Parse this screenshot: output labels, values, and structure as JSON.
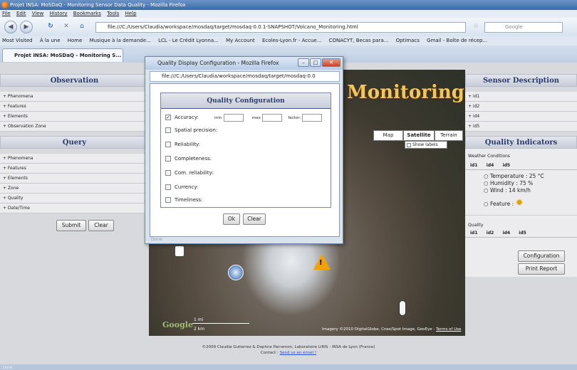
{
  "window": {
    "title": "Projet INSA: MoSDaQ - Monitoring Sensor Data Quality - Mozilla Firefox"
  },
  "menu": [
    "File",
    "Edit",
    "View",
    "History",
    "Bookmarks",
    "Tools",
    "Help"
  ],
  "nav": {
    "url": "file:///C:/Users/Claudia/workspace/mosdaq/target/mosdaq-0.0.1-SNAPSHOT/Volcano_Monitoring.html",
    "search_placeholder": "Google"
  },
  "bookmarks": [
    "Most Visited",
    "À la une",
    "Home",
    "Musique à la demande...",
    "LCL - Le Crédit Lyonna...",
    "My Account",
    "Ecoles-Lyon.fr - Accue...",
    "CONACYT, Becas para...",
    "Optimacs",
    "Gmail - Boîte de récep..."
  ],
  "tab": {
    "label": "Projet INSA: MoSDaQ - Monitoring S..."
  },
  "observation": {
    "title": "Observation",
    "items": [
      "+ Phenomena",
      "+ Features",
      "+ Elements",
      "+ Observation Zone"
    ]
  },
  "query": {
    "title": "Query",
    "items": [
      "+ Phenomena",
      "+ Features",
      "+ Elements",
      "+ Zone",
      "+ Quality",
      "+ Date/Time"
    ],
    "submit": "Submit",
    "clear": "Clear"
  },
  "map": {
    "title": "Monitoring",
    "buttons": [
      "Map",
      "Satellite",
      "Terrain"
    ],
    "show_labels": "Show labels",
    "scale_mi": "1 mi",
    "scale_km": "2 km",
    "google": "Google",
    "copyright": "Imagery ©2010 DigitalGlobe, Cnes/Spot Image, GeoEye -",
    "terms": "Terms of Use"
  },
  "sensor_description": {
    "title": "Sensor Description",
    "items": [
      "+ id1",
      "+ id2",
      "+ id4",
      "+ id5"
    ]
  },
  "quality_indicators": {
    "title": "Quality Indicators",
    "weather_label": "Weather Conditions",
    "weather_tabs": [
      "id1",
      "id4",
      "id5"
    ],
    "temperature": "Temperature : 25 °C",
    "humidity": "Humidity : 75 %",
    "wind": "Wind : 14 km/h",
    "feature": "Feature :",
    "quality_label": "Quality",
    "quality_tabs": [
      "id1",
      "id2",
      "id4",
      "id5"
    ],
    "configuration": "Configuration",
    "print_report": "Print Report"
  },
  "footer": {
    "line1": "©2009 Claudia Gutierrez & Daphne Parramon, Laboratoire LIRIS - INSA de Lyon (France)",
    "contact": "Contact :",
    "email": "Send us an email !"
  },
  "dialog": {
    "title": "Quality Display Configuration - Mozilla Firefox",
    "url": "file:///C:/Users/Claudia/workspace/mosdaq/target/mosdaq-0.0",
    "heading": "Quality Configuration",
    "accuracy": "Accuracy:",
    "min": "min",
    "max": "max",
    "factor": "factor:",
    "rows": [
      "Spatial precision:",
      "Reliability:",
      "Completeness:",
      "Com. reliability:",
      "Currency:",
      "Timeliness:"
    ],
    "ok": "Ok",
    "clear": "Clear",
    "status": "Done"
  },
  "status": "Done"
}
